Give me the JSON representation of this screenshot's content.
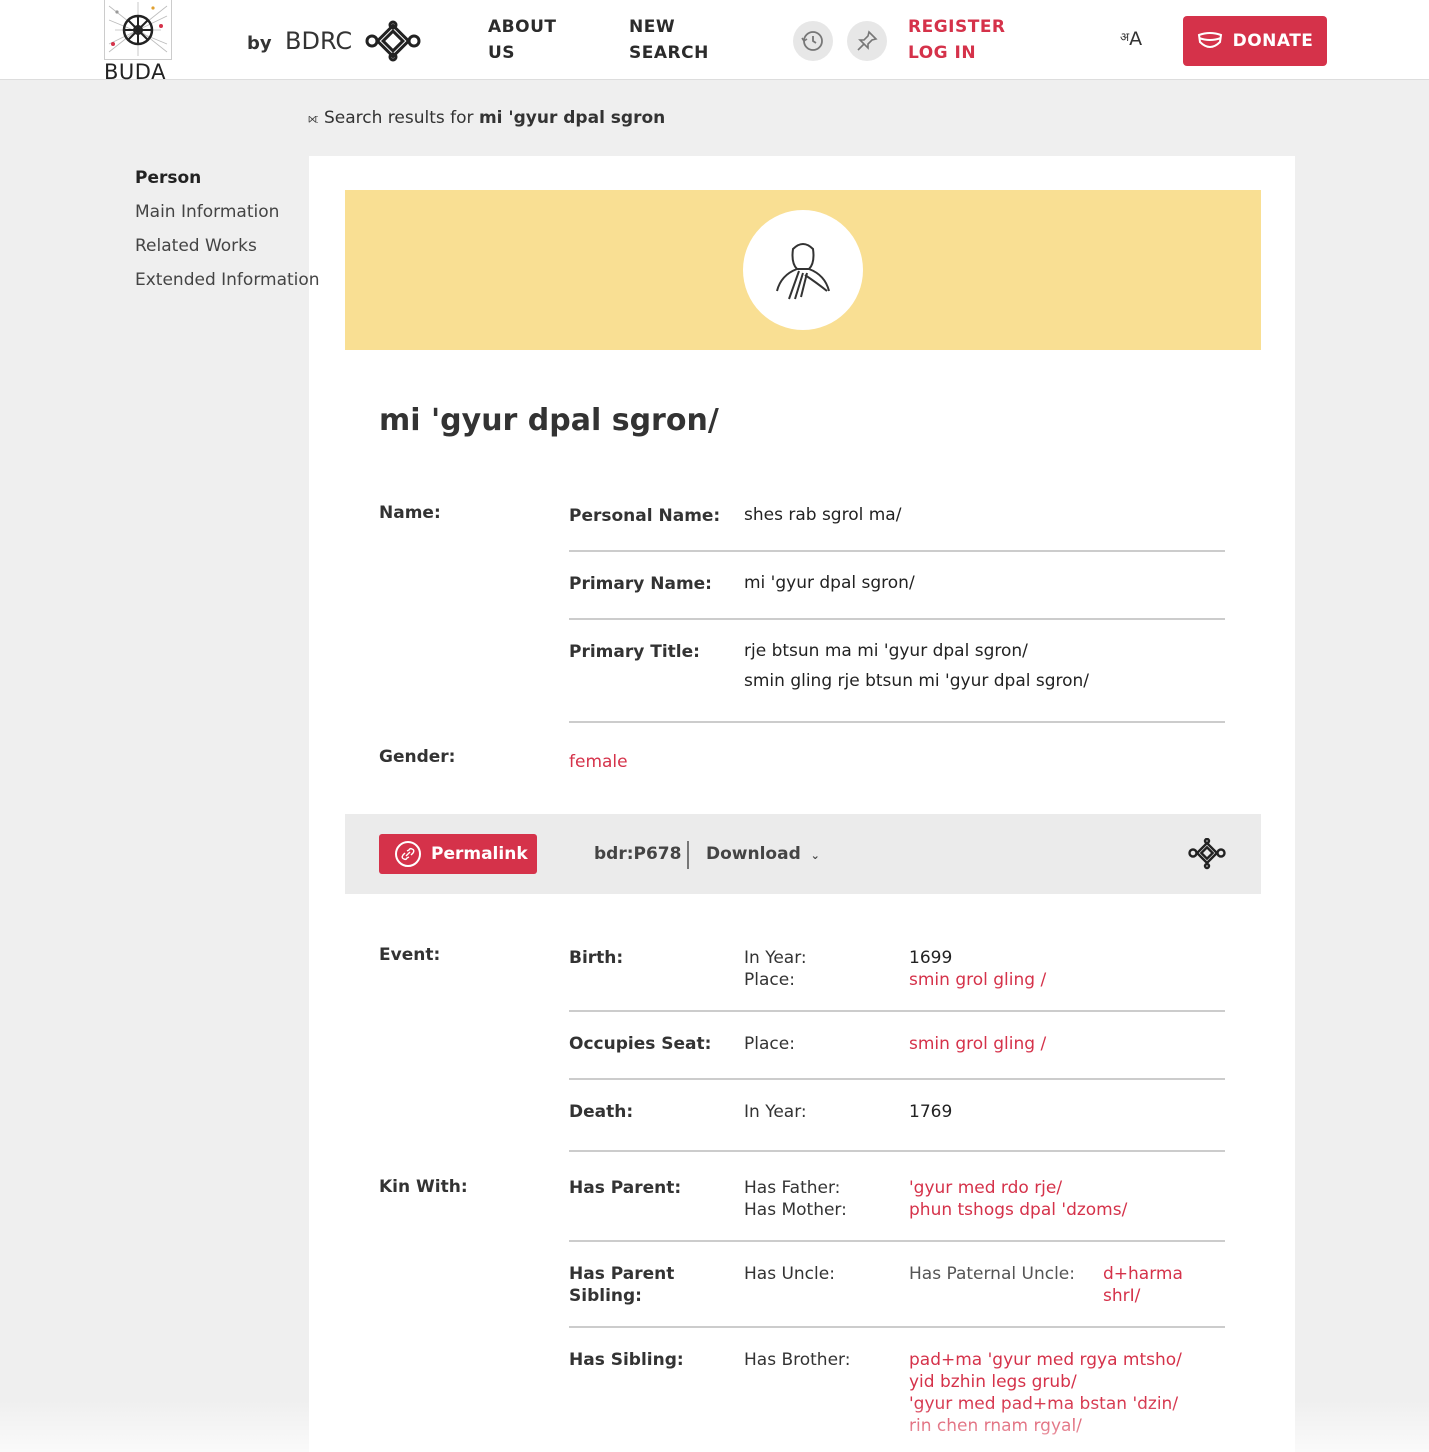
{
  "header": {
    "logo_text": "BUDA",
    "by": "by",
    "org": "BDRC",
    "nav": {
      "about_line1": "About",
      "about_line2": "Us",
      "search_line1": "New",
      "search_line2": "Search"
    },
    "register": "Register",
    "login": "Log In",
    "lang_small": "अ",
    "lang_big": "A",
    "donate": "Donate"
  },
  "breadcrumb": {
    "prefix": "Search results for ",
    "query": "mi 'gyur dpal sgron"
  },
  "sidebar": {
    "title": "Person",
    "items": [
      "Main Information",
      "Related Works",
      "Extended Information"
    ]
  },
  "person": {
    "name": "mi 'gyur dpal sgron/",
    "name_label": "Name:",
    "personal_name_label": "Personal Name:",
    "personal_name": "shes rab sgrol ma/",
    "primary_name_label": "Primary Name:",
    "primary_name": "mi 'gyur dpal sgron/",
    "primary_title_label": "Primary Title:",
    "primary_titles": [
      "rje btsun ma mi 'gyur dpal sgron/",
      "smin gling rje btsun mi 'gyur dpal sgron/"
    ],
    "gender_label": "Gender:",
    "gender": "female"
  },
  "permalink_bar": {
    "permalink": "Permalink",
    "id": "bdr:P678",
    "download": "Download"
  },
  "events": {
    "label": "Event:",
    "birth_label": "Birth:",
    "in_year_label": "In Year:",
    "place_label": "Place:",
    "birth_year": "1699",
    "birth_place": "smin grol gling /",
    "seat_label": "Occupies Seat:",
    "seat_place": "smin grol gling /",
    "death_label": "Death:",
    "death_year": "1769"
  },
  "kin": {
    "label": "Kin With:",
    "has_parent": "Has Parent:",
    "has_father": "Has Father:",
    "has_mother": "Has Mother:",
    "father": "'gyur med rdo rje/",
    "mother": "phun tshogs dpal 'dzoms/",
    "has_parent_sibling_1": "Has Parent",
    "has_parent_sibling_2": "Sibling:",
    "has_uncle": "Has Uncle:",
    "has_paternal_uncle": "Has Paternal Uncle:",
    "uncle_1": "d+harma",
    "uncle_2": "shrI/",
    "has_sibling": "Has Sibling:",
    "has_brother": "Has Brother:",
    "brothers": [
      "pad+ma 'gyur med rgya mtsho/",
      "yid bzhin legs grub/",
      "'gyur med pad+ma bstan 'dzin/",
      "rin chen rnam rgyal/"
    ]
  }
}
